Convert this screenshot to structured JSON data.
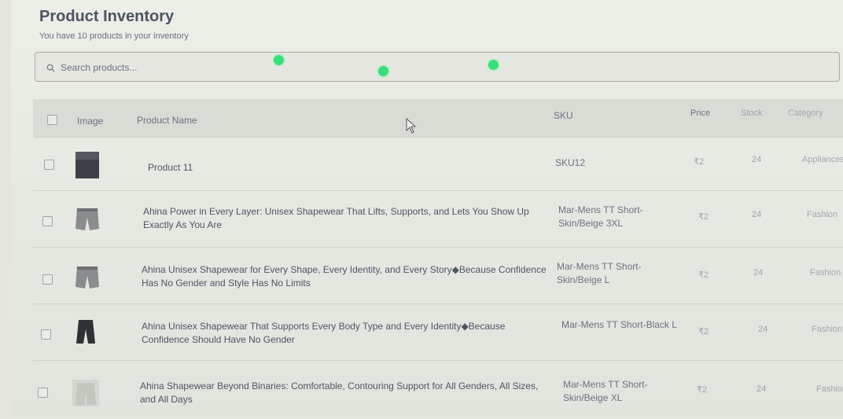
{
  "header": {
    "title": "Product Inventory",
    "subtitle": "You have 10 products in your inventory"
  },
  "search": {
    "placeholder": "Search products...",
    "icon": "search-icon"
  },
  "table": {
    "columns": [
      "Image",
      "Product Name",
      "SKU",
      "Price",
      "Stock",
      "Category"
    ],
    "rows": [
      {
        "name": "Product 11",
        "sku": "SKU12",
        "price": "₹2",
        "stock": "24",
        "category": "Appliances",
        "thumb": "dark-square"
      },
      {
        "name": "Ahina Power in Every Layer: Unisex Shapewear That Lifts, Supports, and Lets You Show Up Exactly As You Are",
        "sku": "Mar-Mens TT Short-Skin/Beige 3XL",
        "price": "₹2",
        "stock": "24",
        "category": "Fashion",
        "thumb": "shorts-beige"
      },
      {
        "name": "Ahina Unisex Shapewear for Every Shape, Every Identity, and Every Story◆Because Confidence Has No Gender and Style Has No Limits",
        "sku": "Mar-Mens TT Short-Skin/Beige L",
        "price": "₹2",
        "stock": "24",
        "category": "Fashion",
        "thumb": "shorts-beige"
      },
      {
        "name": "Ahina Unisex Shapewear That Supports Every Body Type and Every Identity◆Because Confidence Should Have No Gender",
        "sku": "Mar-Mens TT Short-Black L",
        "price": "₹2",
        "stock": "24",
        "category": "Fashion",
        "thumb": "shorts-black"
      },
      {
        "name": "Ahina Shapewear Beyond Binaries: Comfortable, Contouring Support for All Genders, All Sizes, and All Days",
        "sku": "Mar-Mens TT Short-Skin/Beige XL",
        "price": "₹2",
        "stock": "24",
        "category": "Fashion",
        "thumb": "shorts-light"
      }
    ]
  },
  "colors": {
    "indicator_dot": "#35e07a"
  }
}
